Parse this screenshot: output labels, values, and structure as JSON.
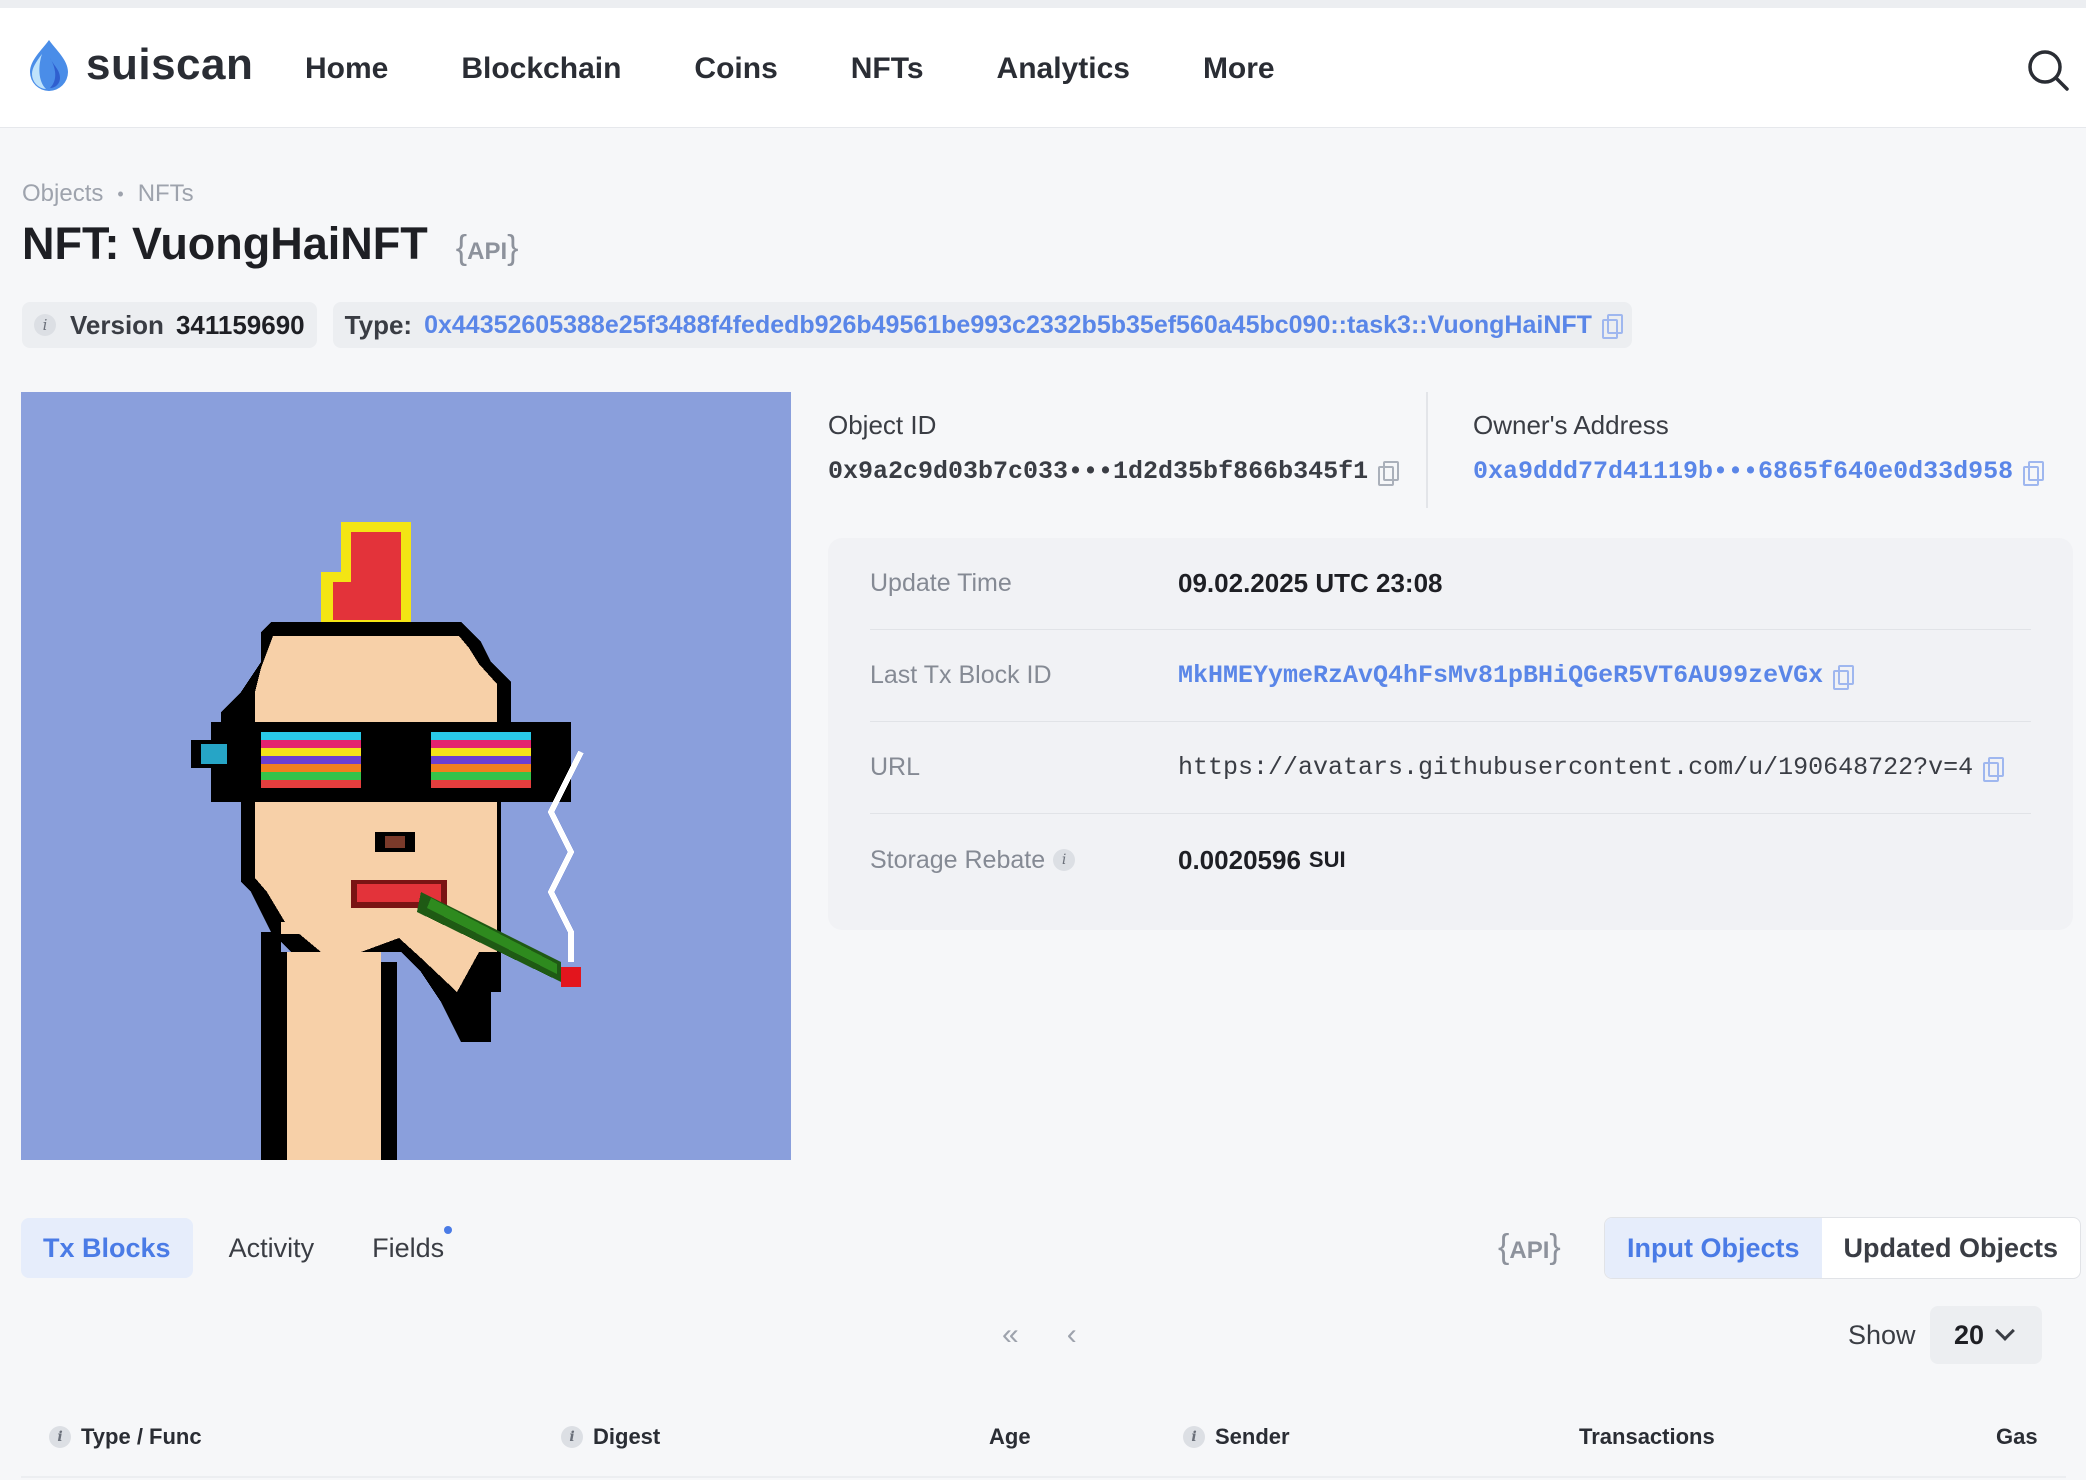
{
  "logo": {
    "text": "suiscan"
  },
  "nav": [
    "Home",
    "Blockchain",
    "Coins",
    "NFTs",
    "Analytics",
    "More"
  ],
  "breadcrumb": [
    "Objects",
    "NFTs"
  ],
  "title": "NFT: VuongHaiNFT",
  "api_label": "API",
  "version": {
    "label": "Version",
    "value": "341159690"
  },
  "type": {
    "label": "Type:",
    "value": "0x44352605388e25f3488f4fededb926b49561be993c2332b5b35ef560a45bc090::task3::VuongHaiNFT"
  },
  "object_id": {
    "label": "Object ID",
    "value": "0x9a2c9d03b7c033•••1d2d35bf866b345f1"
  },
  "owner": {
    "label": "Owner's Address",
    "value": "0xa9ddd77d41119b•••6865f640e0d33d958"
  },
  "details": {
    "update_time": {
      "label": "Update Time",
      "value": "09.02.2025 UTC 23:08"
    },
    "last_tx": {
      "label": "Last Tx Block ID",
      "value": "MkHMEYymeRzAvQ4hFsMv81pBHiQGeR5VT6AU99zeVGx"
    },
    "url": {
      "label": "URL",
      "value": "https://avatars.githubusercontent.com/u/190648722?v=4"
    },
    "storage_rebate": {
      "label": "Storage Rebate",
      "value": "0.0020596",
      "unit": "SUI"
    }
  },
  "tabs": [
    "Tx Blocks",
    "Activity",
    "Fields"
  ],
  "segment": [
    "Input Objects",
    "Updated Objects"
  ],
  "pager": {
    "first": "«",
    "prev": "‹"
  },
  "show": {
    "label": "Show",
    "value": "20"
  },
  "table_headers": [
    "Type / Func",
    "Digest",
    "Age",
    "Sender",
    "Transactions",
    "Gas"
  ],
  "colors": {
    "accent": "#4a7be6",
    "link": "#5a86e8",
    "nft_bg": "#8a9fdc"
  }
}
